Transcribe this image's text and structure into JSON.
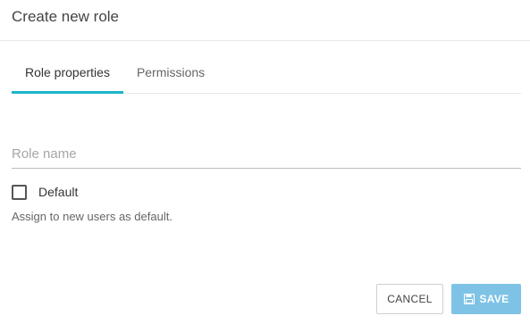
{
  "dialog": {
    "title": "Create new role"
  },
  "tabs": [
    {
      "label": "Role properties",
      "active": true
    },
    {
      "label": "Permissions",
      "active": false
    }
  ],
  "form": {
    "role_name_placeholder": "Role name",
    "role_name_value": "",
    "default_checkbox_label": "Default",
    "default_checked": false,
    "default_hint": "Assign to new users as default."
  },
  "actions": {
    "cancel_label": "CANCEL",
    "save_label": "SAVE",
    "save_icon": "floppy-disk-icon"
  },
  "colors": {
    "accent": "#1bb5c9",
    "save_button": "#7ec3e6"
  }
}
